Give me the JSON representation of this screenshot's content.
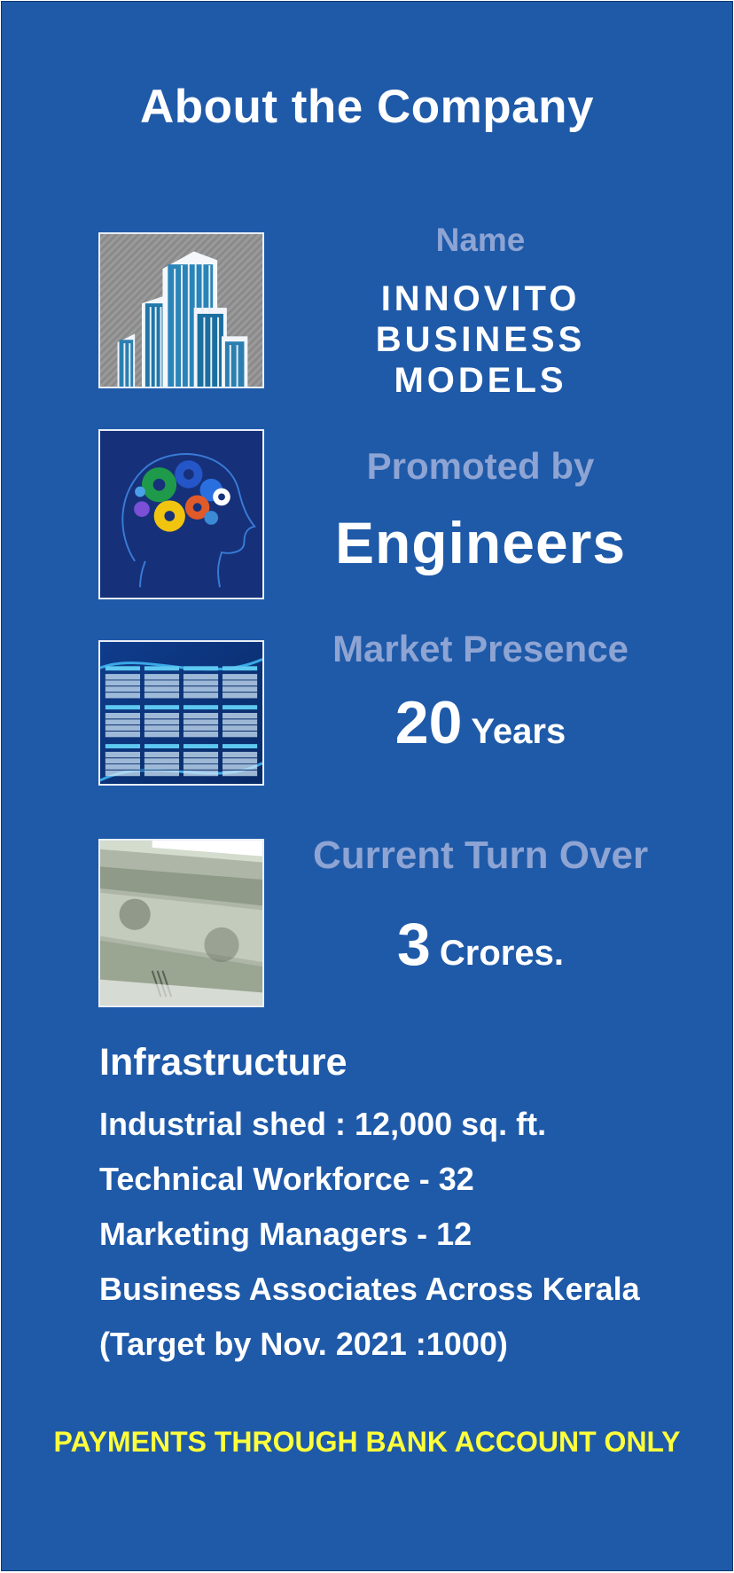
{
  "header": {
    "title": "About the Company"
  },
  "rows": {
    "name": {
      "label": "Name",
      "value_lines": [
        "INNOVITO",
        "BUSINESS",
        "MODELS"
      ],
      "icon": "buildings-icon"
    },
    "promoted": {
      "label": "Promoted by",
      "value": "Engineers",
      "icon": "brain-gears-icon"
    },
    "market": {
      "label": "Market Presence",
      "number": "20",
      "unit": "Years",
      "icon": "calendar-icon"
    },
    "turnover": {
      "label": "Current Turn Over",
      "number": "3",
      "unit": "Crores.",
      "icon": "currency-notes-icon"
    }
  },
  "infrastructure": {
    "title": "Infrastructure",
    "items": [
      "Industrial shed : 12,000 sq. ft.",
      "Technical Workforce - 32",
      "Marketing Managers - 12",
      "Business Associates Across Kerala",
      "(Target by Nov. 2021 :1000)"
    ]
  },
  "notice": "PAYMENTS THROUGH BANK ACCOUNT ONLY",
  "colors": {
    "background": "#1f5aa9",
    "label": "#8ea4d3",
    "value": "#ffffff",
    "notice": "#ffff3b"
  }
}
